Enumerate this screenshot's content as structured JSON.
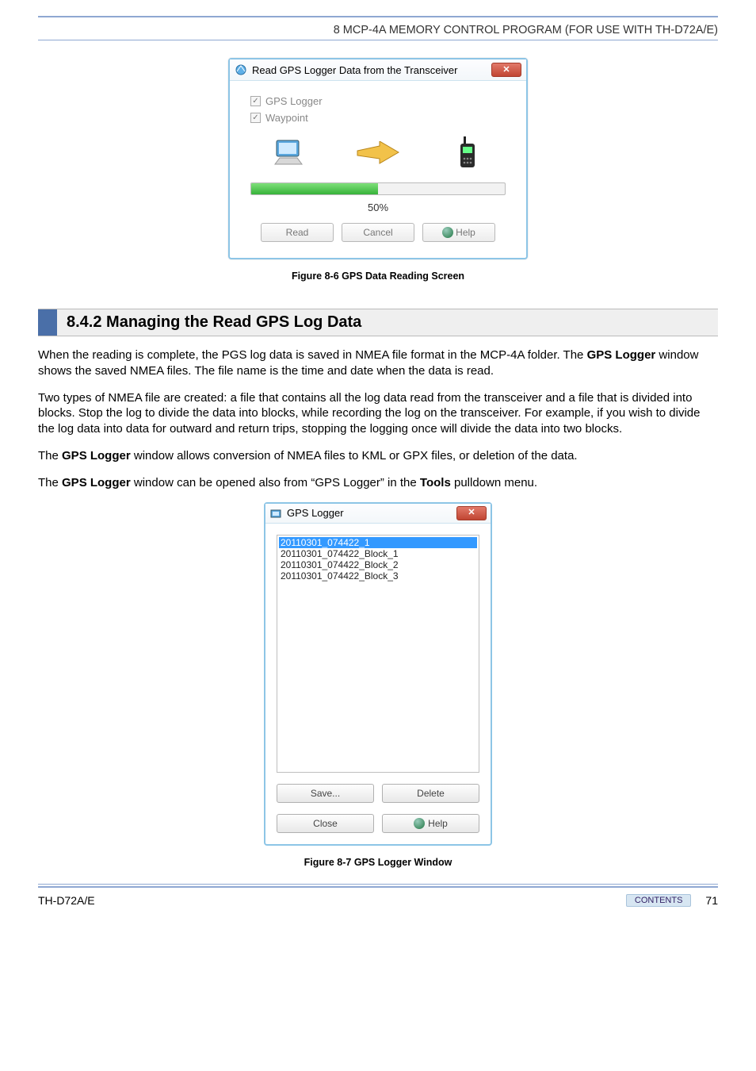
{
  "header": {
    "chapter_line": "8 MCP-4A MEMORY CONTROL PROGRAM (FOR USE WITH TH-D72A/E)"
  },
  "dialog1": {
    "title_text": "Read GPS Logger Data from the Transceiver",
    "chk_gps": "GPS Logger",
    "chk_wp": "Waypoint",
    "progress_pct": 50,
    "progress_label": "50%",
    "btn_read": "Read",
    "btn_cancel": "Cancel",
    "btn_help": "Help"
  },
  "caption1": "Figure 8-6  GPS Data Reading Screen",
  "section_heading": "8.4.2  Managing the Read GPS Log Data",
  "paragraphs": {
    "p1a": "When the reading is complete, the PGS log data is saved in NMEA file format in the MCP-4A folder. The ",
    "p1b": "GPS Logger",
    "p1c": " window shows the saved NMEA files.  The file name is the time and date when the data is read.",
    "p2": "Two types of NMEA file are created: a file that contains all the log data read from the transceiver and a file that is divided into blocks.  Stop the log to divide the data into blocks, while recording the log on the transceiver.  For example, if you wish to divide the log data into data for outward and return trips, stopping the logging once will divide the data into two blocks.",
    "p3a": "The ",
    "p3b": "GPS Logger",
    "p3c": " window allows conversion of NMEA files to KML or GPX files, or deletion of the data.",
    "p4a": "The ",
    "p4b": "GPS Logger",
    "p4c": " window can be opened also from “GPS Logger” in the ",
    "p4d": "Tools",
    "p4e": " pulldown menu."
  },
  "dialog2": {
    "title_text": "GPS Logger",
    "items": [
      "20110301_074422_1",
      "20110301_074422_Block_1",
      "20110301_074422_Block_2",
      "20110301_074422_Block_3"
    ],
    "btn_save": "Save...",
    "btn_delete": "Delete",
    "btn_close": "Close",
    "btn_help": "Help"
  },
  "caption2": "Figure 8-7  GPS Logger Window",
  "footer": {
    "left": "TH-D72A/E",
    "contents": "CONTENTS",
    "page": "71"
  },
  "colors": {
    "accent": "#4a6fa8"
  }
}
